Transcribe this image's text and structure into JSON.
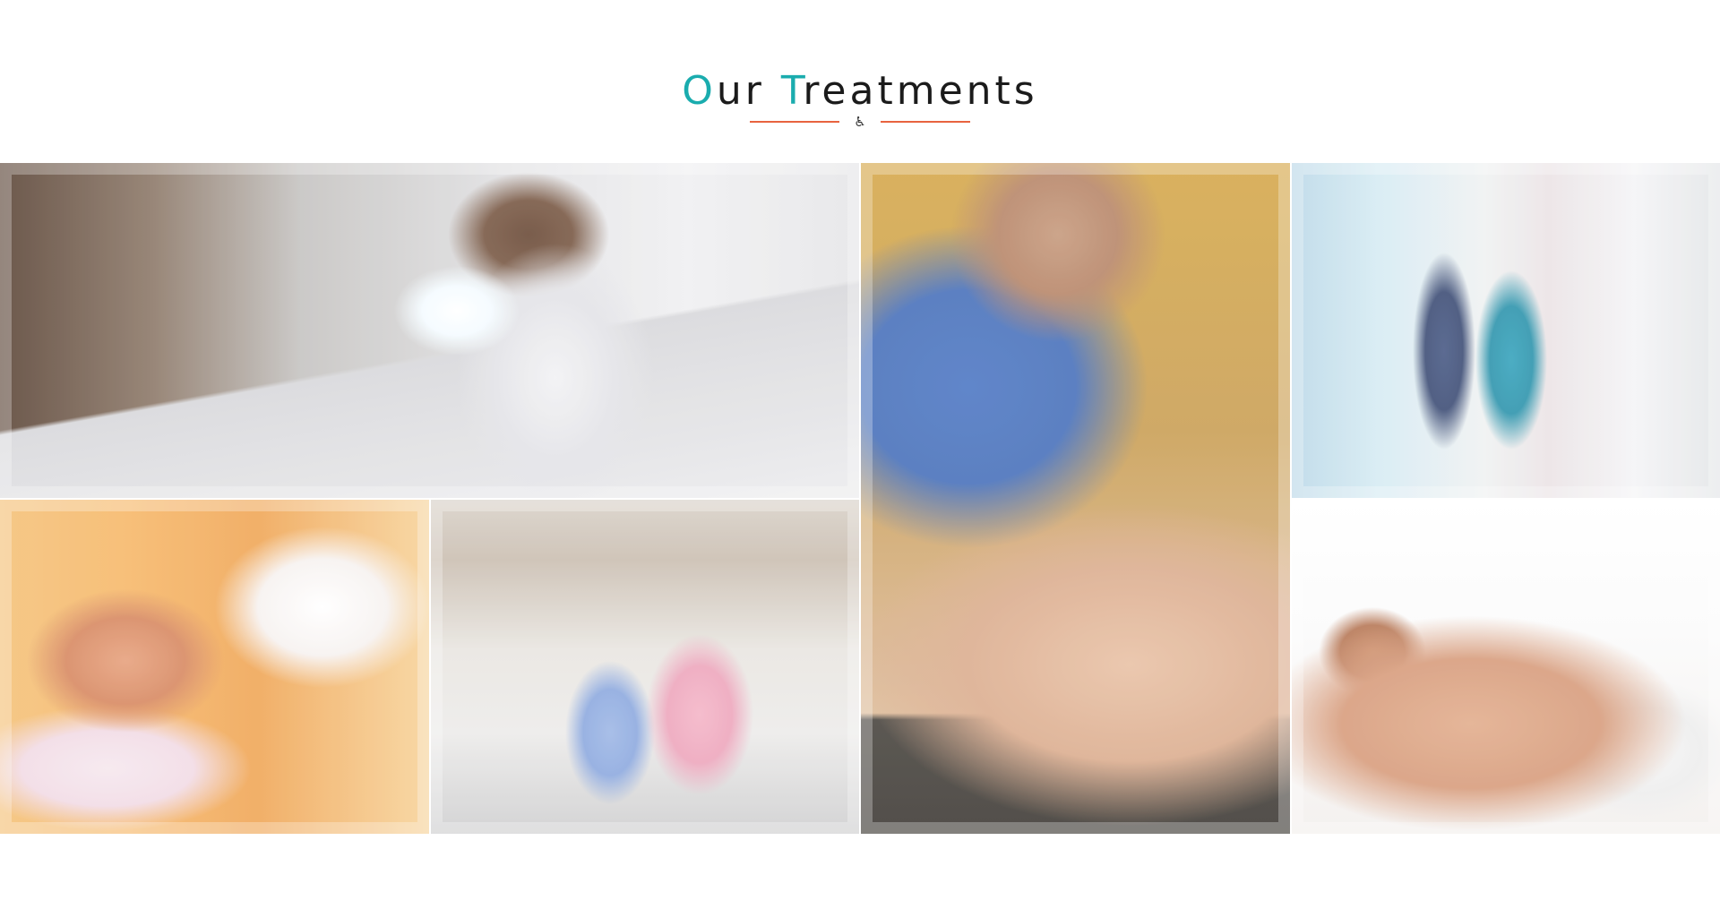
{
  "section": {
    "title_first_letter": "O",
    "title_first_rest": "ur",
    "title_second_letter": "T",
    "title_second_rest": "reatments",
    "divider_icon": "♿",
    "accent_color": "#1aacae",
    "divider_color": "#e8633f"
  },
  "gallery": {
    "items": [
      {
        "name": "podiatry-photo"
      },
      {
        "name": "relaxing-massage-photo"
      },
      {
        "name": "nurse-wheelchair-photo"
      },
      {
        "name": "back-massage-photo"
      },
      {
        "name": "hospital-corridor-photo"
      },
      {
        "name": "roller-massage-photo"
      }
    ]
  }
}
